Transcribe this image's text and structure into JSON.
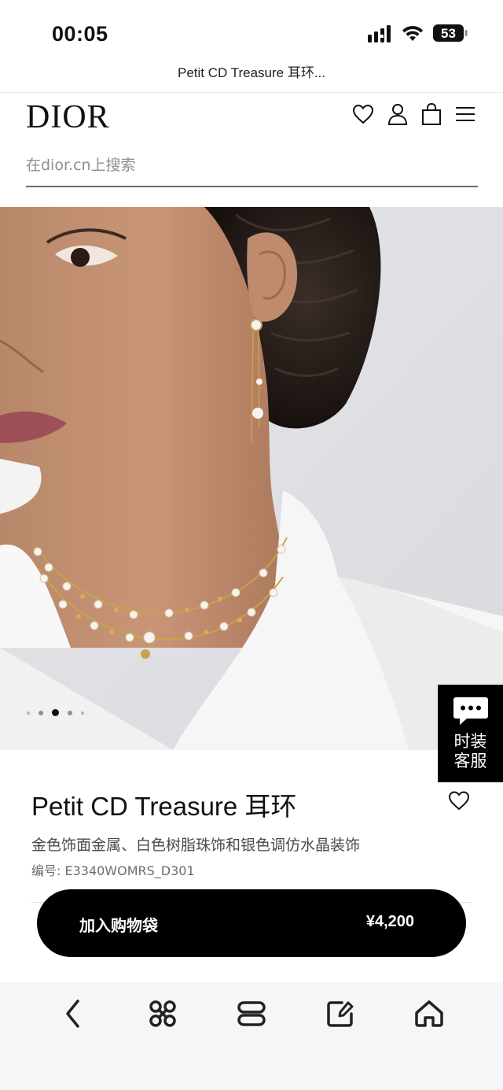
{
  "status_bar": {
    "time": "00:05",
    "battery": "53",
    "icons": [
      "cellular-signal-icon",
      "wifi-icon",
      "battery-icon"
    ]
  },
  "browser": {
    "title": "Petit CD Treasure 耳环..."
  },
  "header": {
    "logo": "DIOR",
    "icons": [
      "heart-icon",
      "account-icon",
      "shopping-bag-icon",
      "menu-icon"
    ],
    "search": {
      "placeholder": "在dior.cn上搜索",
      "value": ""
    }
  },
  "gallery": {
    "image_alt": "model wearing pearl earring and double-strand gold pearl necklace",
    "slide_count": 5,
    "active_index": 2
  },
  "chat": {
    "label_line1": "时装",
    "label_line2": "客服"
  },
  "product": {
    "name": "Petit CD Treasure 耳环",
    "description": "金色饰面金属、白色树脂珠饰和银色调仿水晶装饰",
    "sku": "编号: E3340WOMRS_D301",
    "add_to_bag_label": "加入购物袋",
    "price": "¥4,200"
  },
  "toolbar": {
    "items": [
      "back-icon",
      "command-icon",
      "tabs-icon",
      "edit-icon",
      "home-icon"
    ]
  },
  "colors": {
    "accent": "#000000",
    "background": "#ffffff",
    "toolbar_bg": "#f6f6f8"
  }
}
